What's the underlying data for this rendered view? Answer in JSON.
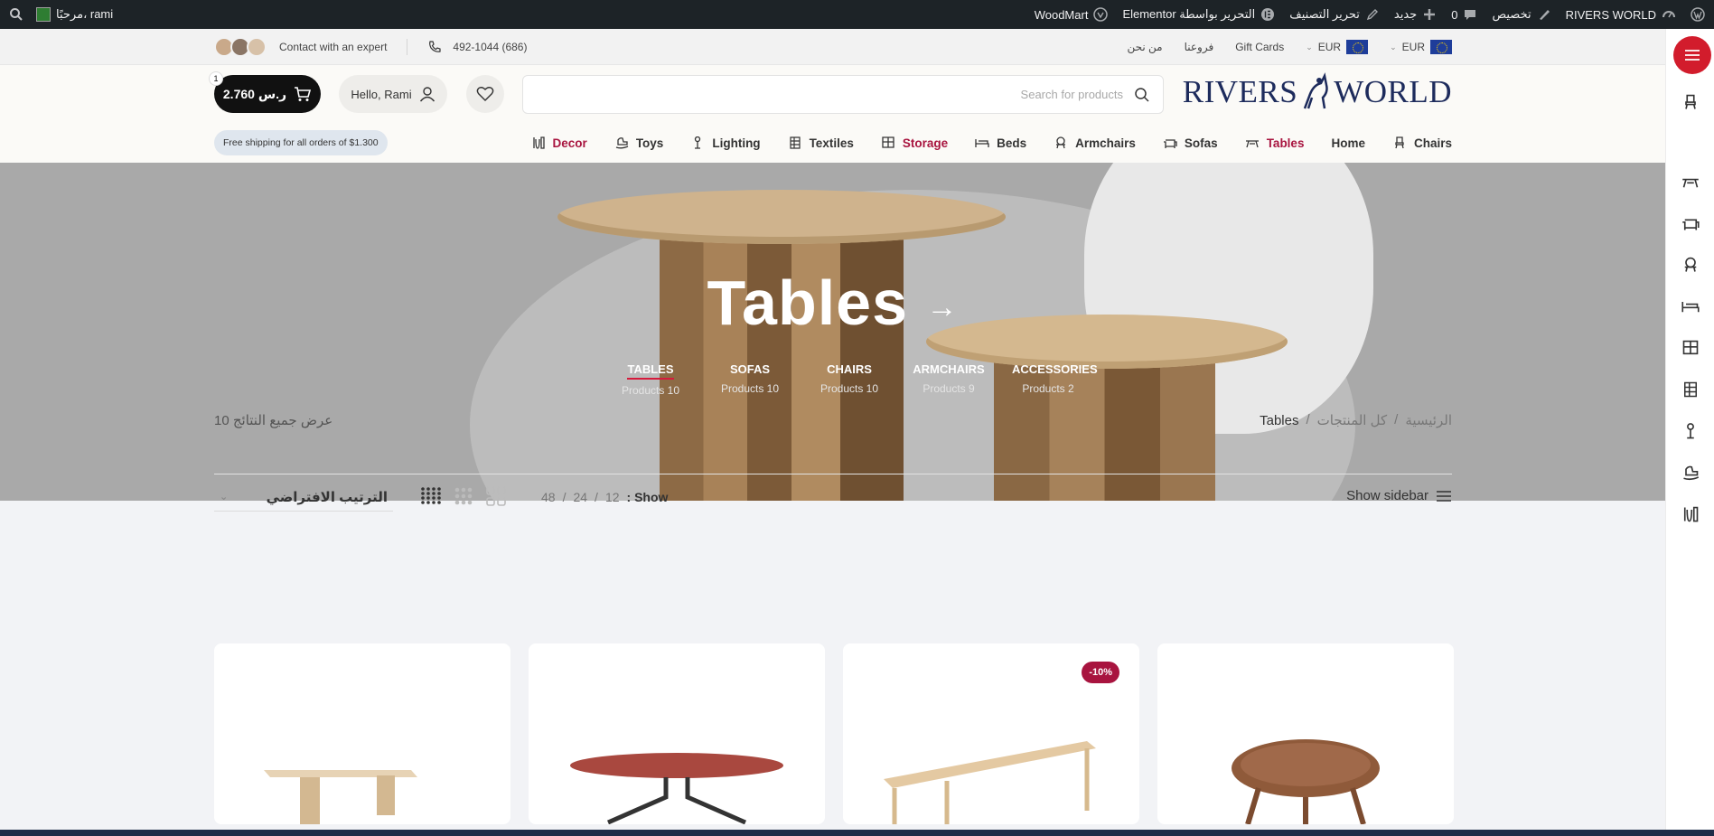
{
  "wp_admin_bar": {
    "site_name": "RIVERS WORLD",
    "customize": "تخصيص",
    "comments_count": "0",
    "new_label": "جديد",
    "edit_category": "تحرير التصنيف",
    "edit_elementor": "التحرير بواسطة Elementor",
    "woodmart": "WoodMart",
    "greeting": "مرحبًا، rami"
  },
  "topbar": {
    "contact_label": "Contact with an expert",
    "phone": "492-1044 (686)",
    "links": [
      "من نحن",
      "فروعنا",
      "Gift Cards"
    ],
    "currency_1": "EUR",
    "currency_2": "EUR"
  },
  "header": {
    "logo_text_1": "RIVERS",
    "logo_text_2": "WORLD",
    "search_placeholder": "Search for products",
    "user_greeting": "Hello, Rami",
    "cart_total": "2.760 ر.س",
    "cart_count": "1",
    "shipping_note": "Free shipping for all orders of $1.300"
  },
  "main_nav": [
    {
      "label": "Chairs",
      "icon": "chair-icon",
      "highlight": false
    },
    {
      "label": "Home",
      "icon": "",
      "highlight": false
    },
    {
      "label": "Tables",
      "icon": "table-icon",
      "highlight": true
    },
    {
      "label": "Sofas",
      "icon": "sofa-icon",
      "highlight": false
    },
    {
      "label": "Armchairs",
      "icon": "armchair-icon",
      "highlight": false
    },
    {
      "label": "Beds",
      "icon": "bed-icon",
      "highlight": false
    },
    {
      "label": "Storage",
      "icon": "storage-icon",
      "highlight": true
    },
    {
      "label": "Textiles",
      "icon": "textiles-icon",
      "highlight": false
    },
    {
      "label": "Lighting",
      "icon": "lamp-icon",
      "highlight": false
    },
    {
      "label": "Toys",
      "icon": "rocking-horse-icon",
      "highlight": false
    },
    {
      "label": "Decor",
      "icon": "vase-icon",
      "highlight": true
    }
  ],
  "hero": {
    "title": "Tables",
    "arrow": "→",
    "categories": [
      {
        "name": "TABLES",
        "count": "Products 10",
        "active": true
      },
      {
        "name": "SOFAS",
        "count": "Products 10",
        "active": false
      },
      {
        "name": "CHAIRS",
        "count": "Products 10",
        "active": false
      },
      {
        "name": "ARMCHAIRS",
        "count": "Products 9",
        "active": false
      },
      {
        "name": "ACCESSORIES",
        "count": "Products 2",
        "active": false
      }
    ]
  },
  "listing": {
    "results_text": "عرض جميع النتائج 10",
    "breadcrumbs": [
      "الرئيسية",
      "كل المنتجات",
      "Tables"
    ],
    "sort_label": "الترتيب الافتراضي",
    "show_label": "Show",
    "per_page": [
      "12",
      "24",
      "48"
    ],
    "sidebar_label": "Show sidebar",
    "products": [
      {
        "badge": ""
      },
      {
        "badge": ""
      },
      {
        "badge": "-10%"
      },
      {
        "badge": ""
      }
    ]
  },
  "colors": {
    "accent_red": "#a8143f",
    "brand_navy": "#1d2b5c",
    "menu_button": "#d21c2c"
  }
}
